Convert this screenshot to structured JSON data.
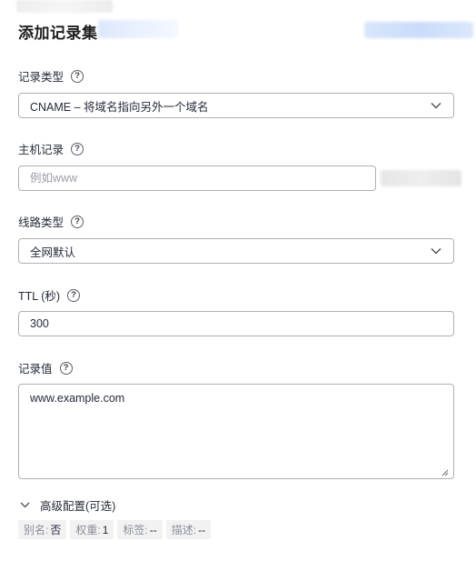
{
  "header": {
    "title": "添加记录集"
  },
  "record_type": {
    "label": "记录类型",
    "value": "CNAME – 将域名指向另外一个域名"
  },
  "host_record": {
    "label": "主机记录",
    "placeholder": "例如www",
    "value": ""
  },
  "line_type": {
    "label": "线路类型",
    "value": "全网默认"
  },
  "ttl": {
    "label": "TTL (秒)",
    "value": "300"
  },
  "record_value": {
    "label": "记录值",
    "value": "www.example.com"
  },
  "advanced": {
    "label": "高级配置(可选)"
  },
  "summary_tags": [
    {
      "key": "别名:",
      "value": "否"
    },
    {
      "key": "权重:",
      "value": "1"
    },
    {
      "key": "标签:",
      "value": "--"
    },
    {
      "key": "描述:",
      "value": "--"
    }
  ],
  "icons": {
    "help": "question-circle-icon",
    "dropdown": "chevron-down-icon",
    "resize": "resize-grip-icon"
  }
}
